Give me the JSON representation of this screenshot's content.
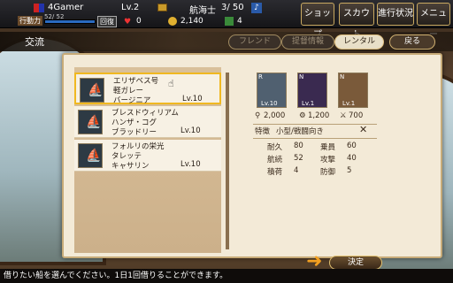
{
  "player": {
    "name": "4Gamer",
    "level": "Lv.2",
    "rank": "航海士",
    "ship_count": "3/ 50",
    "stamina_label": "行動力",
    "stamina_value": "52/ 52",
    "recover_label": "回復",
    "gems": "0",
    "gold": "2,140",
    "tickets": "4"
  },
  "menu": {
    "shop": "ショップ",
    "scout": "スカウト",
    "progress": "進行状況",
    "main": "メニュー"
  },
  "screen": {
    "title": "交流",
    "tab_friend": "フレンド",
    "tab_support": "提督情報",
    "tab_rental": "レンタル",
    "back": "戻る"
  },
  "ships": [
    {
      "line1": "エリザベス号",
      "line2": "軽ガレー",
      "line3": "バージニア",
      "level": "Lv.10",
      "selected": true
    },
    {
      "line1": "ブレスドウィリアム",
      "line2": "ハンザ・コグ",
      "line3": "ブラッドリー",
      "level": "Lv.10",
      "selected": false
    },
    {
      "line1": "フォルリの栄光",
      "line2": "タレッテ",
      "line3": "キャサリン",
      "level": "Lv.10",
      "selected": false
    }
  ],
  "crew": [
    {
      "rank": "R",
      "level": "Lv.10",
      "value": "2,000"
    },
    {
      "rank": "N",
      "level": "Lv.1",
      "value": "1,200"
    },
    {
      "rank": "N",
      "level": "Lv.1",
      "value": "700"
    }
  ],
  "detail": {
    "feature_label": "特徴",
    "feature_value": "小型/戦闘向き",
    "stats": [
      {
        "label": "耐久",
        "value": "80"
      },
      {
        "label": "乗員",
        "value": "60"
      },
      {
        "label": "航続",
        "value": "52"
      },
      {
        "label": "攻撃",
        "value": "40"
      },
      {
        "label": "積荷",
        "value": "4"
      },
      {
        "label": "防御",
        "value": "5"
      }
    ]
  },
  "confirm": "決定",
  "hint": "借りたい船を選んでください。1日1回借りることができます。"
}
